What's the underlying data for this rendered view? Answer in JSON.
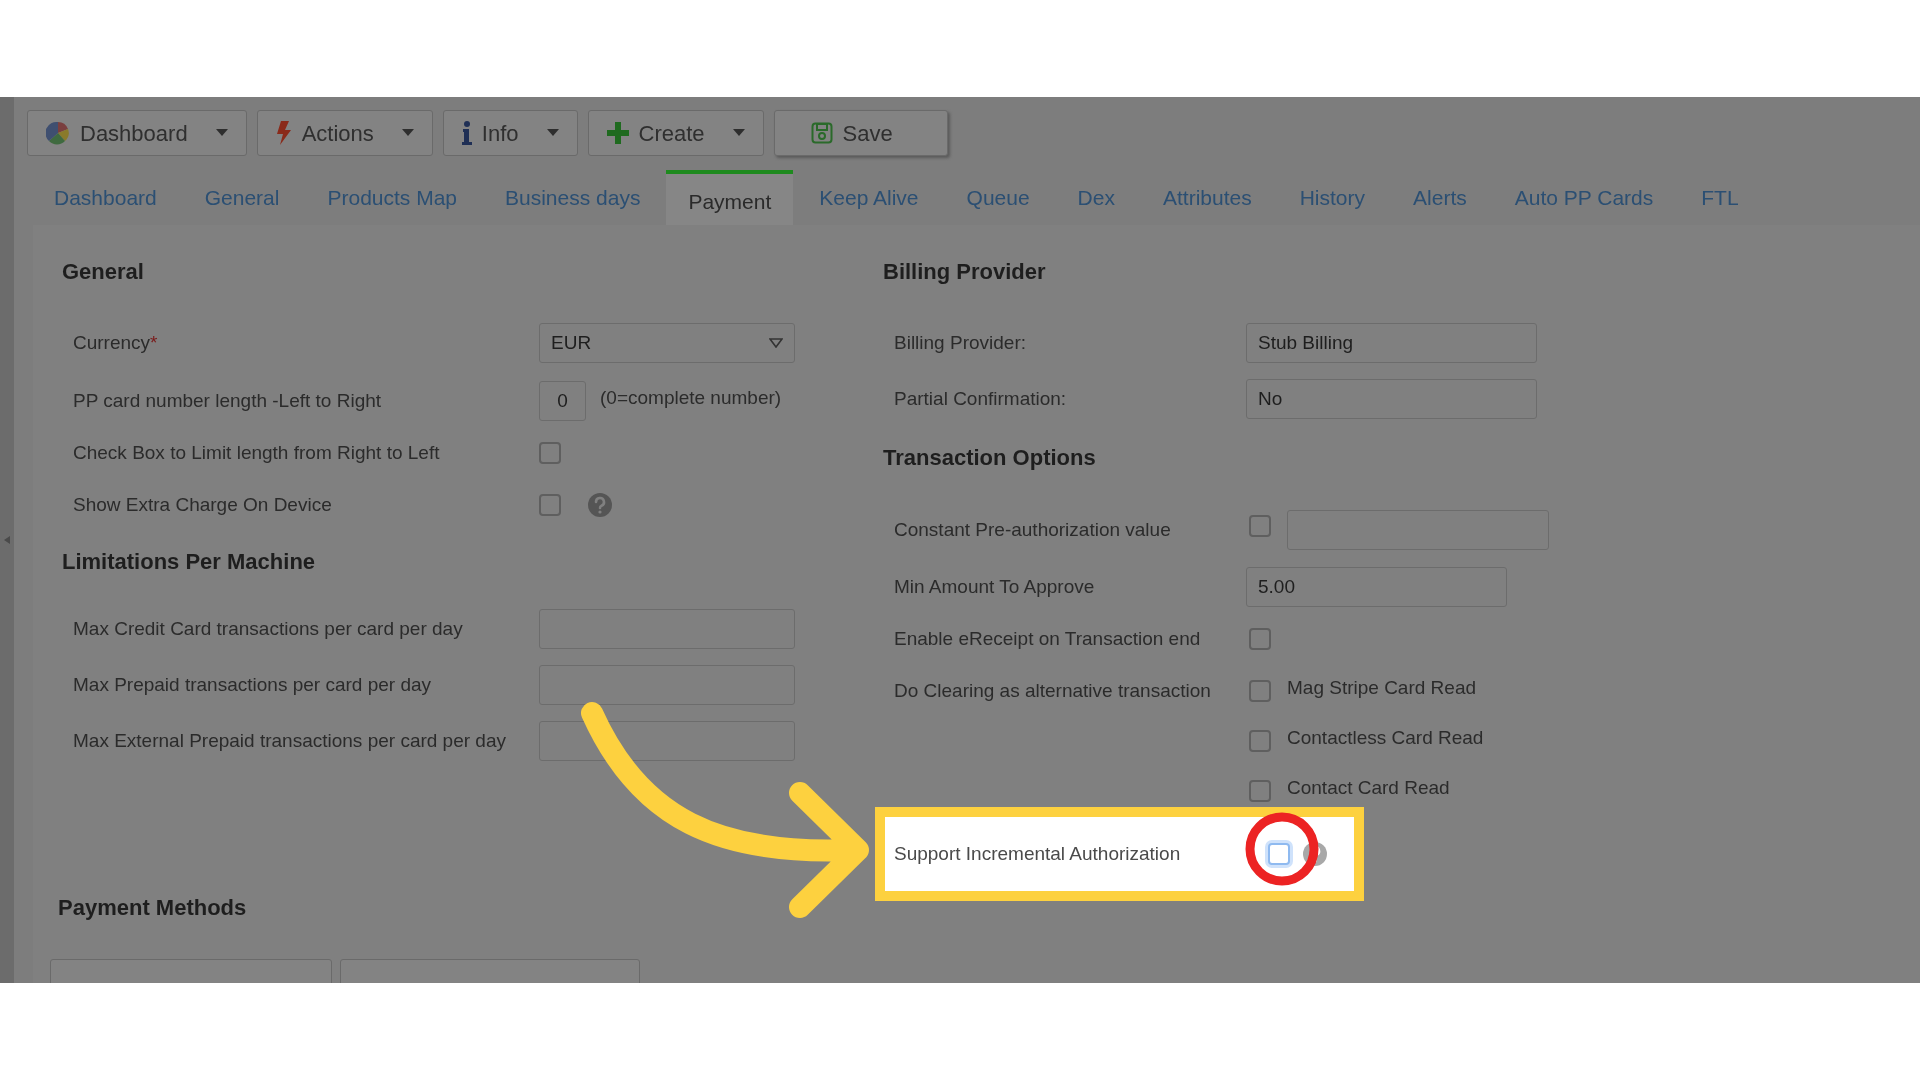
{
  "toolbar": [
    {
      "label": "Dashboard",
      "dropdown": true
    },
    {
      "label": "Actions",
      "dropdown": true
    },
    {
      "label": "Info",
      "dropdown": true
    },
    {
      "label": "Create",
      "dropdown": true
    },
    {
      "label": "Save",
      "dropdown": false
    }
  ],
  "tabs": [
    {
      "label": "Dashboard",
      "selected": false
    },
    {
      "label": "General",
      "selected": false
    },
    {
      "label": "Products Map",
      "selected": false
    },
    {
      "label": "Business days",
      "selected": false
    },
    {
      "label": "Payment",
      "selected": true
    },
    {
      "label": "Keep Alive",
      "selected": false
    },
    {
      "label": "Queue",
      "selected": false
    },
    {
      "label": "Dex",
      "selected": false
    },
    {
      "label": "Attributes",
      "selected": false
    },
    {
      "label": "History",
      "selected": false
    },
    {
      "label": "Alerts",
      "selected": false
    },
    {
      "label": "Auto PP Cards",
      "selected": false
    },
    {
      "label": "FTL",
      "selected": false
    }
  ],
  "general": {
    "heading": "General",
    "fields": [
      {
        "kind": "select",
        "label": "Currency",
        "required_mark": "*",
        "value": "EUR"
      },
      {
        "kind": "number",
        "label": "PP card number length -Left to Right",
        "value": "0",
        "note": "(0=complete number)"
      },
      {
        "kind": "checkbox",
        "label": "Check Box to Limit length from Right to Left",
        "checked": false,
        "help": false
      },
      {
        "kind": "checkbox",
        "label": "Show Extra Charge On Device",
        "checked": false,
        "help": true
      }
    ]
  },
  "limitations": {
    "heading": "Limitations Per Machine",
    "fields": [
      {
        "kind": "text",
        "label": "Max Credit Card transactions per card per day"
      },
      {
        "kind": "text",
        "label": "Max Prepaid transactions per card per day"
      },
      {
        "kind": "text",
        "label": "Max External Prepaid transactions per card per day"
      }
    ]
  },
  "payment_methods": {
    "heading": "Payment Methods"
  },
  "billing": {
    "heading": "Billing Provider",
    "fields": [
      {
        "kind": "readonly",
        "label": "Billing Provider:",
        "value": "Stub Billing"
      },
      {
        "kind": "readonly",
        "label": "Partial Confirmation:",
        "value": "No"
      }
    ]
  },
  "transaction_options": {
    "heading": "Transaction Options",
    "fields": [
      {
        "kind": "checkbox_text",
        "label": "Constant Pre-authorization value",
        "checked": false
      },
      {
        "kind": "text",
        "label": "Min Amount To Approve",
        "value": "5.00"
      },
      {
        "kind": "checkbox",
        "label": "Enable eReceipt on Transaction end",
        "checked": false,
        "help": false,
        "highlighted": false
      },
      {
        "kind": "options",
        "label": "Do Clearing as alternative transaction",
        "options": [
          {
            "label": "Mag Stripe Card Read",
            "checked": false
          },
          {
            "label": "Contactless Card Read",
            "checked": false
          },
          {
            "label": "Contact Card Read",
            "checked": false
          }
        ]
      },
      {
        "kind": "checkbox",
        "label": "Support Incremental Authorization",
        "checked": false,
        "help": true,
        "highlighted": true
      }
    ]
  }
}
